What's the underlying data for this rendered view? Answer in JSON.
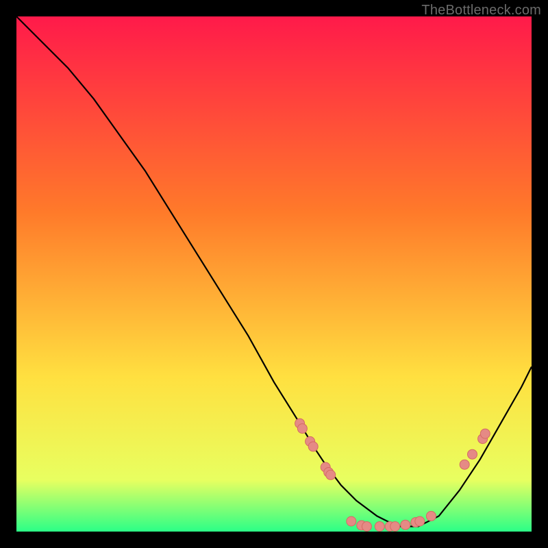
{
  "watermark": "TheBottleneck.com",
  "colors": {
    "background": "#000000",
    "gradient_top": "#ff1a4a",
    "gradient_mid1": "#ff7a2a",
    "gradient_mid2": "#ffe040",
    "gradient_bottom1": "#e8ff60",
    "gradient_bottom2": "#2bff87",
    "curve": "#000000",
    "dot_fill": "#e58a85",
    "dot_stroke": "#d46a64"
  },
  "chart_data": {
    "type": "line",
    "title": "",
    "xlabel": "",
    "ylabel": "",
    "xlim": [
      0,
      100
    ],
    "ylim": [
      0,
      100
    ],
    "series": [
      {
        "name": "bottleneck-curve",
        "x": [
          0,
          5,
          10,
          15,
          20,
          25,
          30,
          35,
          40,
          45,
          50,
          55,
          58,
          60,
          63,
          66,
          70,
          74,
          78,
          82,
          86,
          90,
          94,
          98,
          100
        ],
        "y": [
          100,
          95,
          90,
          84,
          77,
          70,
          62,
          54,
          46,
          38,
          29,
          21,
          16,
          13,
          9,
          6,
          3,
          1,
          1,
          3,
          8,
          14,
          21,
          28,
          32
        ]
      }
    ],
    "points": [
      {
        "name": "p1",
        "x": 55.0,
        "y": 21.0
      },
      {
        "name": "p2",
        "x": 55.5,
        "y": 20.0
      },
      {
        "name": "p3",
        "x": 57.0,
        "y": 17.5
      },
      {
        "name": "p4",
        "x": 57.6,
        "y": 16.5
      },
      {
        "name": "p5",
        "x": 60.0,
        "y": 12.5
      },
      {
        "name": "p6",
        "x": 60.6,
        "y": 11.5
      },
      {
        "name": "p7",
        "x": 61.0,
        "y": 11.0
      },
      {
        "name": "p8",
        "x": 65.0,
        "y": 2.0
      },
      {
        "name": "p9",
        "x": 67.0,
        "y": 1.2
      },
      {
        "name": "p10",
        "x": 68.0,
        "y": 1.0
      },
      {
        "name": "p11",
        "x": 70.5,
        "y": 1.0
      },
      {
        "name": "p12",
        "x": 72.5,
        "y": 1.0
      },
      {
        "name": "p13",
        "x": 73.5,
        "y": 1.0
      },
      {
        "name": "p14",
        "x": 75.5,
        "y": 1.3
      },
      {
        "name": "p15",
        "x": 77.5,
        "y": 1.8
      },
      {
        "name": "p16",
        "x": 78.3,
        "y": 2.0
      },
      {
        "name": "p17",
        "x": 80.5,
        "y": 3.0
      },
      {
        "name": "p18",
        "x": 87.0,
        "y": 13.0
      },
      {
        "name": "p19",
        "x": 88.5,
        "y": 15.0
      },
      {
        "name": "p20",
        "x": 90.5,
        "y": 18.0
      },
      {
        "name": "p21",
        "x": 91.0,
        "y": 19.0
      }
    ],
    "gradient_stops": [
      {
        "offset": 0.0,
        "color_key": "gradient_top"
      },
      {
        "offset": 0.38,
        "color_key": "gradient_mid1"
      },
      {
        "offset": 0.7,
        "color_key": "gradient_mid2"
      },
      {
        "offset": 0.9,
        "color_key": "gradient_bottom1"
      },
      {
        "offset": 1.0,
        "color_key": "gradient_bottom2"
      }
    ]
  }
}
